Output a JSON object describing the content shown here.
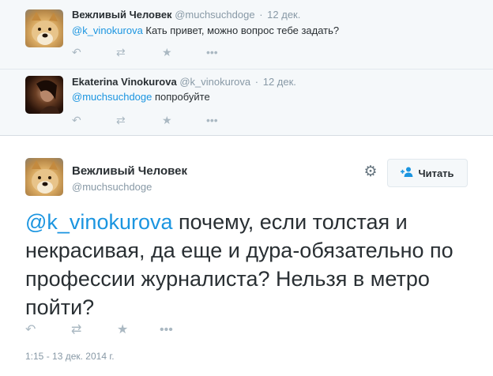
{
  "replies": [
    {
      "fullname": "Вежливый Человек",
      "username": "@muchsuchdoge",
      "separator": "·",
      "time": "12 дек.",
      "mention": "@k_vinokurova",
      "text": " Кать привет, можно вопрос тебе задать?"
    },
    {
      "fullname": "Ekaterina Vinokurova",
      "username": "@k_vinokurova",
      "separator": "·",
      "time": "12 дек.",
      "mention": "@muchsuchdoge",
      "text": " попробуйте"
    }
  ],
  "actions": {
    "reply_icon": "↶",
    "retweet_icon": "⇄",
    "favorite_icon": "★",
    "more_icon": "•••"
  },
  "main": {
    "fullname": "Вежливый Человек",
    "username": "@muchsuchdoge",
    "follow_label": "Читать",
    "follow_icon": "person-plus-icon",
    "mention": "@k_vinokurova",
    "text": " почему,  если толстая и некрасивая, да еще и  дура-обязательно по профессии журналиста? Нельзя в метро пойти?",
    "timestamp": "1:15 - 13 дек. 2014 г."
  },
  "colors": {
    "link": "#1b95e0",
    "muted": "#8899a6",
    "reply_bg": "#f5f8fa"
  }
}
